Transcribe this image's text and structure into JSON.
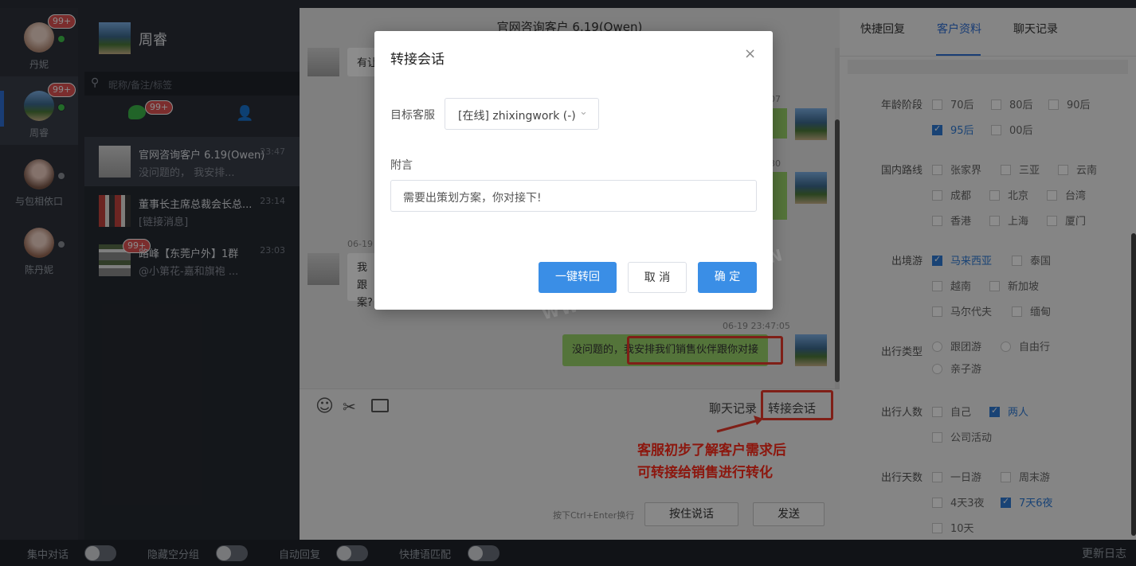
{
  "rail": {
    "contacts": [
      {
        "name": "丹妮",
        "badge": "99+"
      },
      {
        "name": "周睿",
        "badge": "99+"
      },
      {
        "name": "与包相依口"
      },
      {
        "name": "陈丹妮"
      }
    ]
  },
  "convlist": {
    "header_name": "周睿",
    "search_placeholder": "昵称/备注/标签",
    "tab_badge": "99+",
    "items": [
      {
        "title": "官网咨询客户 6.19(Owen)",
        "time": "23:47",
        "sub": "没问题的， 我安排..."
      },
      {
        "title": "董事长主席总裁会长总...",
        "time": "23:14",
        "sub": "[链接消息]"
      },
      {
        "title": "路峰【东莞户外】1群",
        "time": "23:03",
        "sub": "@小第花-嘉和旗袍 ...",
        "badge": "99+"
      }
    ]
  },
  "chat": {
    "title": "官网咨询客户 6.19(Owen)",
    "msg1_fragment": "有让",
    "time1": "07",
    "time2": "30",
    "date3": "06-19",
    "msg3_line1": "我跟",
    "msg3_line2": "案?",
    "time4": "06-19 23:47:05",
    "msg4_prefix": "没问题的，",
    "msg4_highlight": "我安排我们销售伙伴跟你对接",
    "history_link": "聊天记录",
    "transfer_link": "转接会话",
    "hint": "按下Ctrl+Enter换行",
    "hold_to_talk": "按住说话",
    "send": "发送"
  },
  "annotation": {
    "line1": "客服初步了解客户需求后",
    "line2": "可转接给销售进行转化"
  },
  "right_panel": {
    "tabs": [
      "快捷回复",
      "客户资料",
      "聊天记录"
    ],
    "active_tab": "客户资料",
    "groups": {
      "age": {
        "label": "年龄阶段",
        "options": [
          "70后",
          "80后",
          "90后",
          "95后",
          "00后"
        ],
        "checked": [
          "95后"
        ]
      },
      "domestic": {
        "label": "国内路线",
        "options": [
          "张家界",
          "三亚",
          "云南",
          "成都",
          "北京",
          "台湾",
          "香港",
          "上海",
          "厦门"
        ]
      },
      "abroad": {
        "label": "出境游",
        "options": [
          "马来西亚",
          "泰国",
          "越南",
          "新加坡",
          "马尔代夫",
          "缅甸"
        ],
        "checked": [
          "马来西亚"
        ]
      },
      "trip_type": {
        "label": "出行类型",
        "options": [
          "跟团游",
          "自由行",
          "亲子游"
        ]
      },
      "people": {
        "label": "出行人数",
        "options": [
          "自己",
          "两人",
          "公司活动"
        ],
        "checked": [
          "两人"
        ]
      },
      "days": {
        "label": "出行天数",
        "options": [
          "一日游",
          "周末游",
          "4天3夜",
          "7天6夜",
          "10天"
        ],
        "checked": [
          "7天6夜"
        ]
      }
    }
  },
  "bottombar": {
    "toggles": [
      "集中对话",
      "隐藏空分组",
      "自动回复",
      "快捷语匹配"
    ],
    "update_log": "更新日志"
  },
  "modal": {
    "title": "转接会话",
    "target_label": "目标客服",
    "target_value": "[在线] zhixingwork (-)",
    "note_label": "附言",
    "note_value": "需要出策划方案，你对接下!",
    "btn_transfer_back": "一键转回",
    "btn_cancel": "取 消",
    "btn_ok": "确 定"
  },
  "watermark": "WWW.ZHIXINGWORK.CN",
  "colors": {
    "primary": "#3a8ee6",
    "active_tab": "#2f6fd6",
    "annotation": "#e83a2a",
    "bubble_green": "#9ad36a"
  }
}
